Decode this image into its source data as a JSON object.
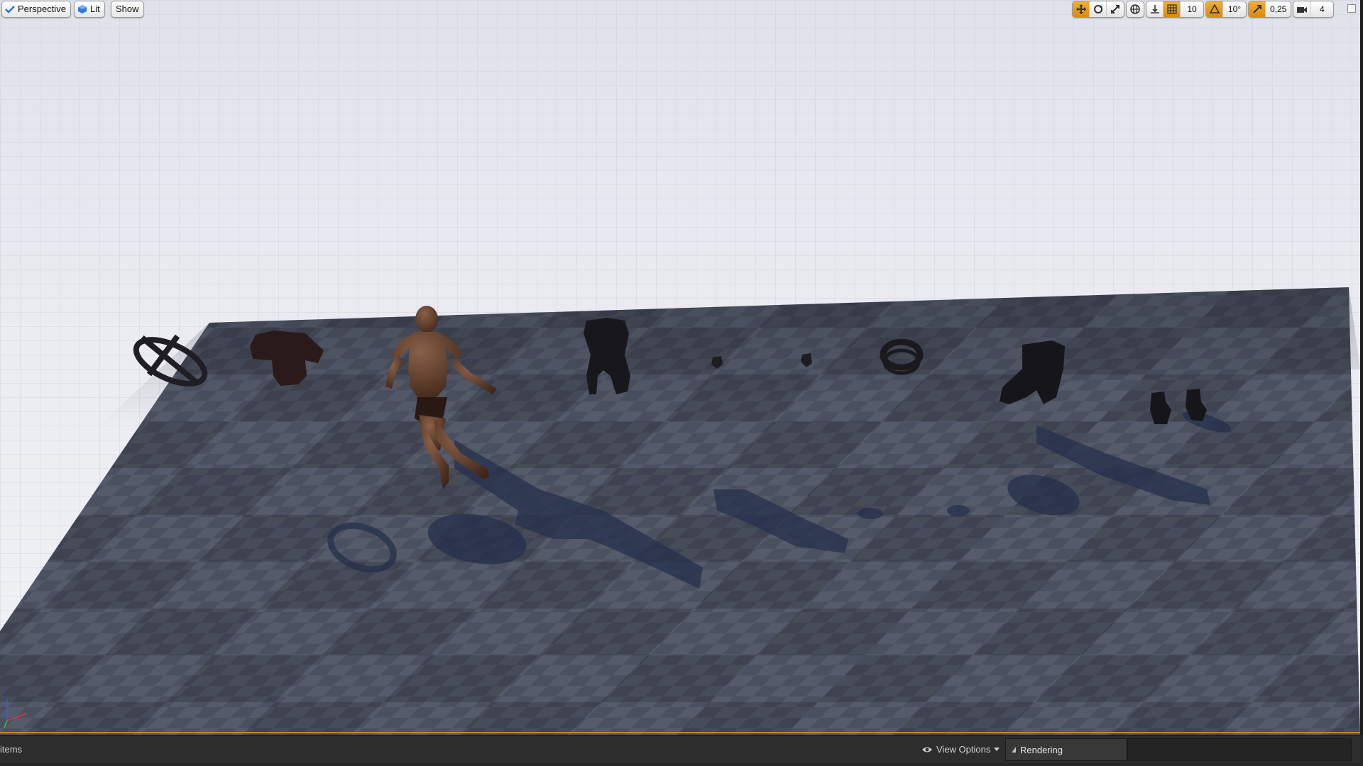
{
  "viewport": {
    "view_mode_label": "Perspective",
    "lighting_label": "Lit",
    "show_label": "Show"
  },
  "toolbar_right": {
    "grid_snap_value": "10",
    "rotation_snap_value": "10°",
    "scale_snap_value": "0,25",
    "camera_speed_value": "4"
  },
  "bottom_bar": {
    "items_label": "items",
    "view_options_label": "View Options",
    "rendering_tab_label": "Rendering"
  },
  "scene_objects": [
    "harness-strap",
    "shirt",
    "character-body",
    "vest",
    "small-piece-left",
    "small-piece-right",
    "belt",
    "pants",
    "boots"
  ],
  "colors": {
    "accent": "#d88a0f",
    "viewport_border": "#b88d1a",
    "floor_dark": "#3d4250",
    "floor_light": "#6b7080"
  }
}
